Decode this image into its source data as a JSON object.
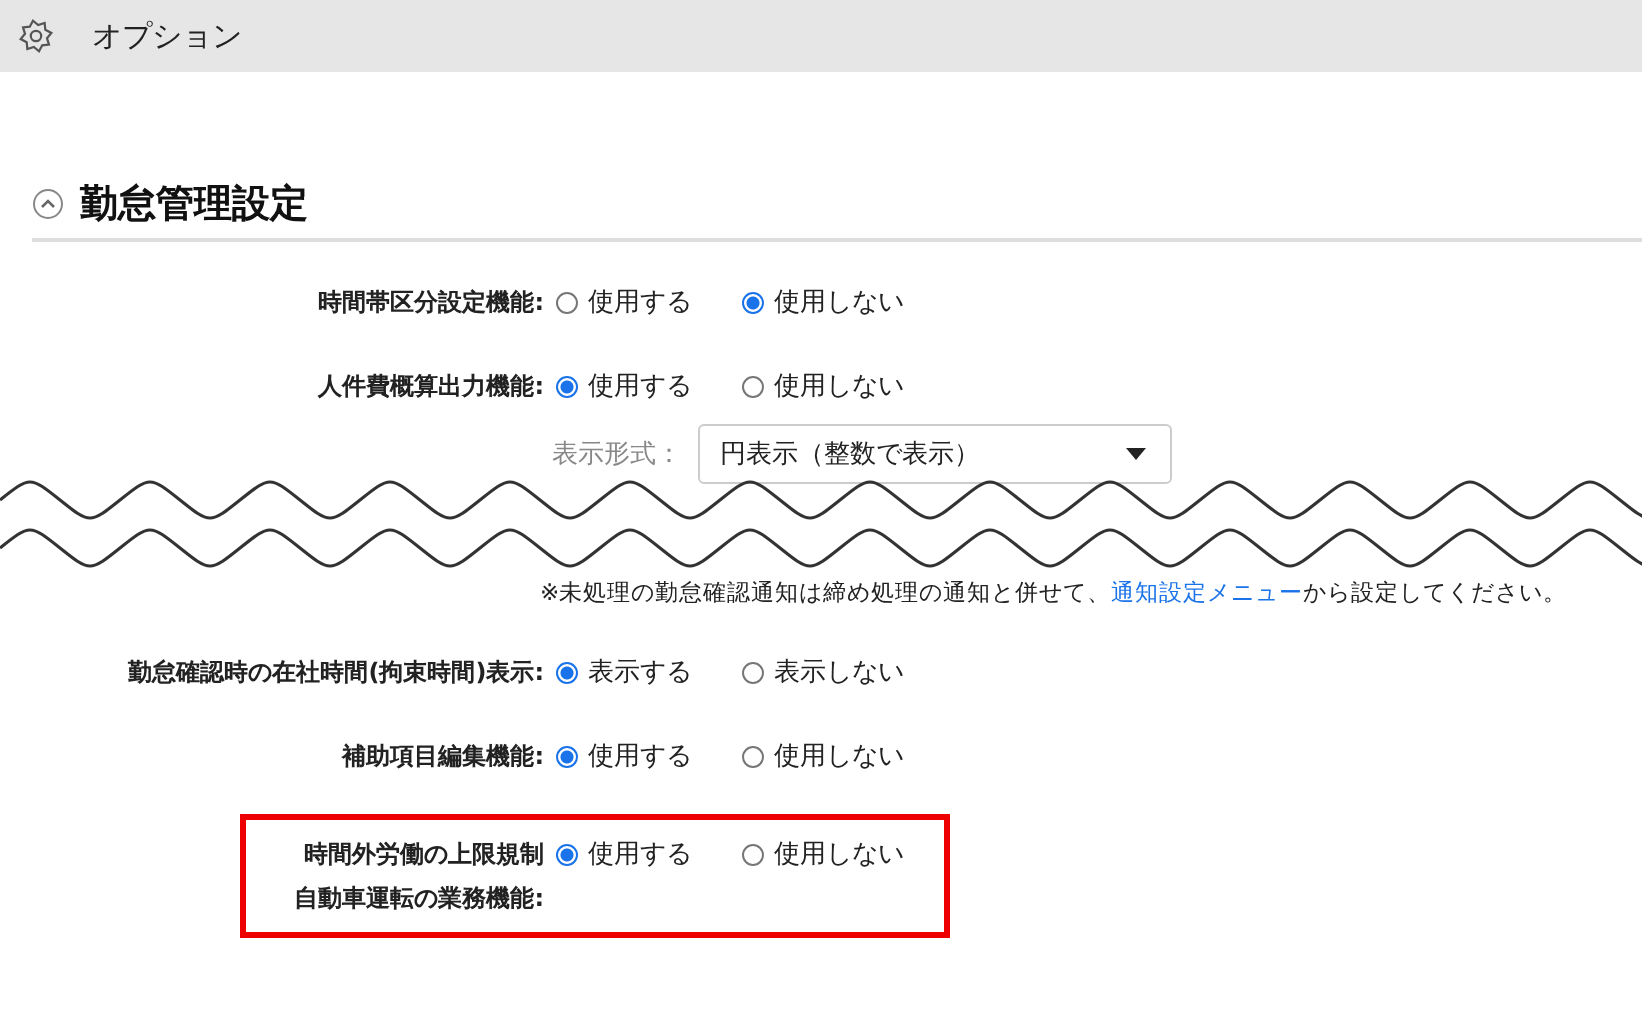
{
  "header": {
    "title": "オプション"
  },
  "section": {
    "title": "勤怠管理設定",
    "expanded": true
  },
  "settings": [
    {
      "kind": "radio",
      "label": "時間帯区分設定機能:",
      "highlighted": false,
      "options": [
        {
          "label": "使用する",
          "selected": false
        },
        {
          "label": "使用しない",
          "selected": true
        }
      ]
    },
    {
      "kind": "radio",
      "label": "人件費概算出力機能:",
      "highlighted": false,
      "options": [
        {
          "label": "使用する",
          "selected": true
        },
        {
          "label": "使用しない",
          "selected": false
        }
      ]
    },
    {
      "kind": "select",
      "label": "表示形式：",
      "value": "円表示（整数で表示）"
    },
    {
      "kind": "cut"
    },
    {
      "kind": "note",
      "before": "※未処理の勤怠確認通知は締め処理の通知と併せて、",
      "link": "通知設定メニュー",
      "after": "から設定してください。"
    },
    {
      "kind": "radio",
      "label": "勤怠確認時の在社時間(拘束時間)表示:",
      "highlighted": false,
      "options": [
        {
          "label": "表示する",
          "selected": true
        },
        {
          "label": "表示しない",
          "selected": false
        }
      ]
    },
    {
      "kind": "radio",
      "label": "補助項目編集機能:",
      "highlighted": false,
      "options": [
        {
          "label": "使用する",
          "selected": true
        },
        {
          "label": "使用しない",
          "selected": false
        }
      ]
    },
    {
      "kind": "radio",
      "label_lines": [
        "時間外労働の上限規制",
        "自動車運転の業務機能:"
      ],
      "highlighted": true,
      "options": [
        {
          "label": "使用する",
          "selected": true
        },
        {
          "label": "使用しない",
          "selected": false
        }
      ]
    }
  ]
}
